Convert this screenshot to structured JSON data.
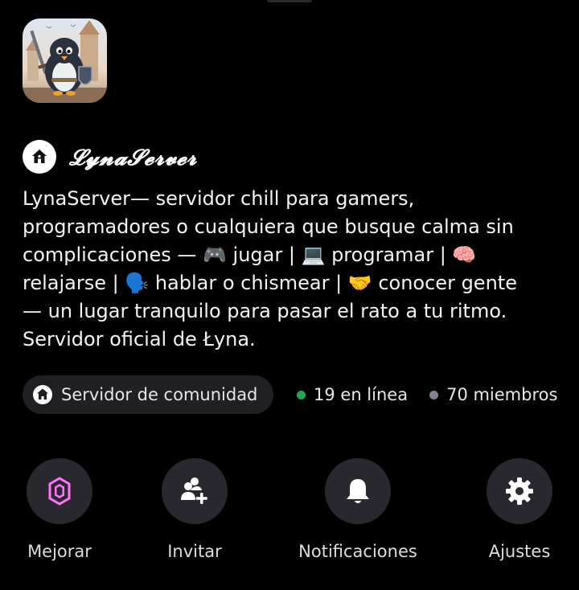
{
  "server": {
    "name": "𝓛𝔂𝓷𝓪𝓢𝓮𝓻𝓿𝓮𝓻",
    "description": "LynaServer— servidor chill para gamers,\nprogramadores o cualquiera que busque calma sin\ncomplicaciones — 🎮 jugar | 💻 programar | 🧠\nrelajarse | 🗣️ hablar o chismear | 🤝 conocer gente\n— un lugar tranquilo para pasar el rato a tu ritmo.\nServidor oficial de Łyna."
  },
  "info": {
    "community_label": "Servidor de comunidad",
    "online": "19 en línea",
    "members": "70 miembros",
    "online_color": "#23a55a",
    "members_color": "#80848e"
  },
  "actions": {
    "boost": {
      "label": "Mejorar",
      "icon": "boost-gem-icon",
      "accent": "#ff73fa"
    },
    "invite": {
      "label": "Invitar",
      "icon": "add-user-icon"
    },
    "notifications": {
      "label": "Notificaciones",
      "icon": "bell-icon"
    },
    "settings": {
      "label": "Ajustes",
      "icon": "gear-icon"
    }
  },
  "colors": {
    "background": "#000000",
    "chip_background": "#1f1f24",
    "action_circle": "#28282e"
  }
}
